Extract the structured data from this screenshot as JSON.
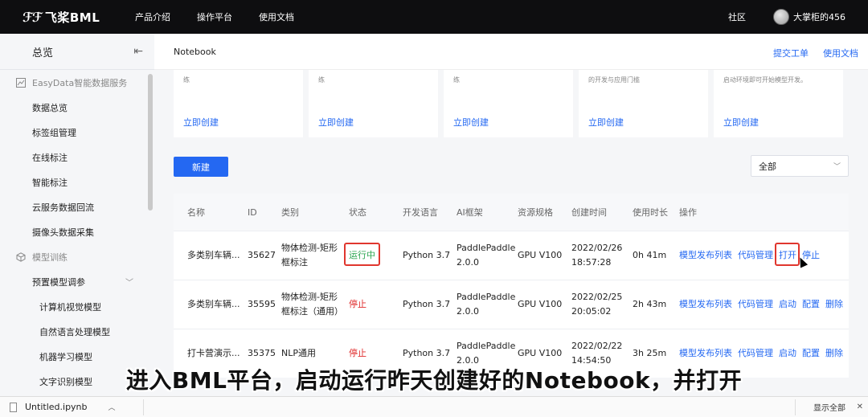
{
  "topnav": {
    "logo_mark": "ℱℱ",
    "logo_text": "飞桨BML",
    "links": [
      "产品介绍",
      "操作平台",
      "使用文档"
    ],
    "community": "社区",
    "username": "大掌柜的456"
  },
  "sidebar": {
    "title": "总览",
    "groups": [
      {
        "label": "EasyData智能数据服务",
        "items": [
          "数据总览",
          "标签组管理",
          "在线标注",
          "智能标注",
          "云服务数据回流",
          "摄像头数据采集"
        ]
      },
      {
        "label": "模型训练",
        "items": [
          "预置模型调参"
        ],
        "subitems": [
          "计算机视觉模型",
          "自然语言处理模型",
          "机器学习模型",
          "文字识别模型"
        ]
      }
    ]
  },
  "main": {
    "breadcrumb": "Notebook",
    "help_links": [
      "提交工单",
      "使用文档"
    ],
    "cards": [
      {
        "desc": "练",
        "link": "立即创建"
      },
      {
        "desc": "练",
        "link": "立即创建"
      },
      {
        "desc": "练",
        "link": "立即创建"
      },
      {
        "desc": "的开发与应用门槛",
        "link": "立即创建"
      },
      {
        "desc": "启动环境即可开始模型开发。",
        "link": "立即创建"
      }
    ],
    "new_button": "新建",
    "filter_value": "全部",
    "table": {
      "headers": [
        "名称",
        "ID",
        "类别",
        "状态",
        "开发语言",
        "AI框架",
        "资源规格",
        "创建时间",
        "使用时长",
        "操作"
      ],
      "rows": [
        {
          "name": "多类别车辆...",
          "id": "35627",
          "category_line1": "物体检测-矩形",
          "category_line2": "框标注",
          "status": "运行中",
          "language": "Python 3.7",
          "framework_line1": "PaddlePaddle",
          "framework_line2": "2.0.0",
          "resource": "GPU V100",
          "created_line1": "2022/02/26",
          "created_line2": "18:57:28",
          "duration": "0h 41m",
          "ops": [
            "模型发布列表",
            "代码管理",
            "打开",
            "停止"
          ]
        },
        {
          "name": "多类别车辆...",
          "id": "35595",
          "category_line1": "物体检测-矩形",
          "category_line2": "框标注（通用）",
          "status": "停止",
          "language": "Python 3.7",
          "framework_line1": "PaddlePaddle",
          "framework_line2": "2.0.0",
          "resource": "GPU V100",
          "created_line1": "2022/02/25",
          "created_line2": "20:05:02",
          "duration": "2h 43m",
          "ops": [
            "模型发布列表",
            "代码管理",
            "启动",
            "配置",
            "删除"
          ]
        },
        {
          "name": "打卡营演示...",
          "id": "35375",
          "category_line1": "NLP通用",
          "category_line2": "",
          "status": "停止",
          "language": "Python 3.7",
          "framework_line1": "PaddlePaddle",
          "framework_line2": "2.0.0",
          "resource": "GPU V100",
          "created_line1": "2022/02/22",
          "created_line2": "14:54:50",
          "duration": "3h 25m",
          "ops": [
            "模型发布列表",
            "代码管理",
            "启动",
            "配置",
            "删除"
          ]
        }
      ]
    }
  },
  "caption": "进入BML平台，启动运行昨天创建好的Notebook，并打开",
  "downloads": {
    "file": "Untitled.ipynb",
    "show_all": "显示全部",
    "close": "✕"
  },
  "icons": {
    "collapse": "collapse-menu-icon",
    "easydata": "chart-line-icon",
    "training": "cube-icon",
    "file": "file-icon"
  },
  "colors": {
    "accent": "#2468f2",
    "running": "#2aa44f",
    "stopped": "#e02d2d",
    "highlight": "#e0362e"
  }
}
